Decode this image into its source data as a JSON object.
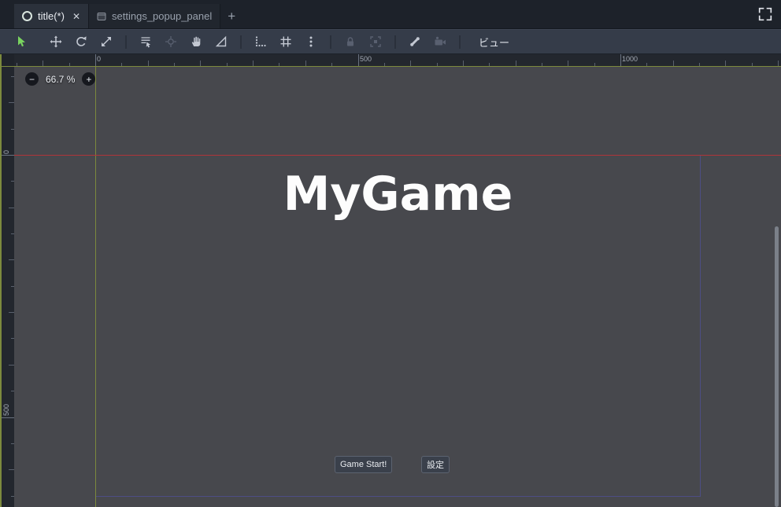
{
  "tab_bar": {
    "tabs": [
      {
        "label": "title(*)",
        "active": true
      },
      {
        "label": "settings_popup_panel",
        "active": false
      }
    ],
    "close_glyph": "✕",
    "add_button_glyph": "+"
  },
  "toolbar": {
    "tools": [
      "select-tool",
      "move-tool",
      "rotate-tool",
      "scale-tool",
      "list-select-tool",
      "pivot-tool",
      "pan-tool",
      "ruler-tool",
      "smart-snap-toggle",
      "grid-snap-toggle",
      "snap-options-menu",
      "lock-button",
      "group-button",
      "skeleton-options-menu",
      "camera-override-button"
    ],
    "view_menu_label": "ビュー"
  },
  "canvas_view": {
    "zoom": {
      "out_glyph": "−",
      "value": "66.7 %",
      "in_glyph": "+"
    },
    "ruler_top_labels": [
      "0",
      "500",
      "1000"
    ],
    "ruler_left_labels": [
      "0",
      "500"
    ],
    "scene": {
      "title_label": "MyGame",
      "start_button_label": "Game Start!",
      "settings_button_label": "設定"
    }
  },
  "colors": {
    "tool_active_green": "#79d35f",
    "axis_x_red": "#b0353a",
    "axis_y_green": "#7c8a3d",
    "frame_border_purple": "#4d4d85",
    "canvas_background": "#47484d"
  }
}
